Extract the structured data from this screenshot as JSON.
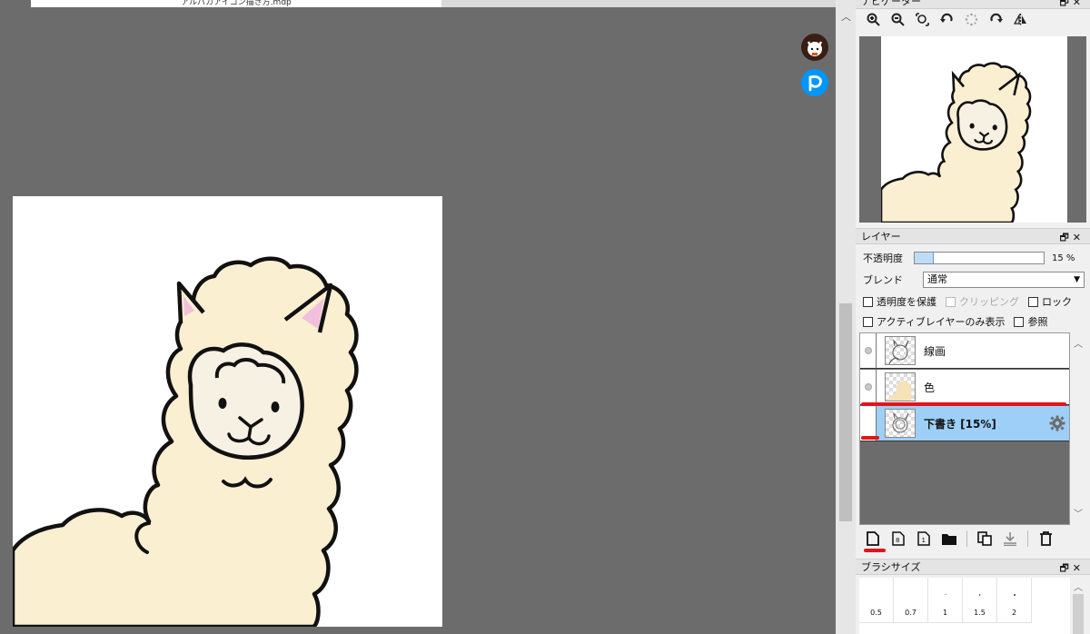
{
  "window": {
    "tab_title": "アルパカアイコン描き方.mdp"
  },
  "panels": {
    "navigator": {
      "title": "ナビゲーター",
      "controls": "🗗✕",
      "tools": [
        "zoom-in-icon",
        "zoom-out-icon",
        "zoom-fit-icon",
        "rotate-left-icon",
        "rotate-reset-icon",
        "rotate-right-icon",
        "flip-horizontal-icon"
      ]
    },
    "layer": {
      "title": "レイヤー",
      "controls": "🗗✕",
      "opacity_label": "不透明度",
      "opacity_value": "15 %",
      "opacity_percent": 15,
      "blend_label": "ブレンド",
      "blend_value": "通常",
      "checks": {
        "protect_alpha": "透明度を保護",
        "clipping": "クリッピング",
        "lock": "ロック",
        "active_only": "アクティブレイヤーのみ表示",
        "reference": "参照"
      },
      "layers": [
        {
          "name": "線画",
          "selected": false
        },
        {
          "name": "色",
          "selected": false
        },
        {
          "name": "下書き [15%]",
          "selected": true
        }
      ],
      "toolbar": [
        "new-layer-icon",
        "new-8bit-layer-icon",
        "new-1bit-layer-icon",
        "folder-icon",
        "duplicate-layer-icon",
        "merge-down-icon",
        "delete-layer-icon"
      ]
    },
    "brush_size": {
      "title": "ブラシサイズ",
      "controls": "🗗✕",
      "sizes": [
        "0.5",
        "0.7",
        "1",
        "1.5",
        "2"
      ]
    }
  },
  "colors": {
    "canvas_bg": "#6c6c6c",
    "selected_layer": "#9dcff7",
    "annotation_red": "#e0141b",
    "pixiv_blue": "#0096fa",
    "alpaca_fur": "#fbefd2"
  }
}
